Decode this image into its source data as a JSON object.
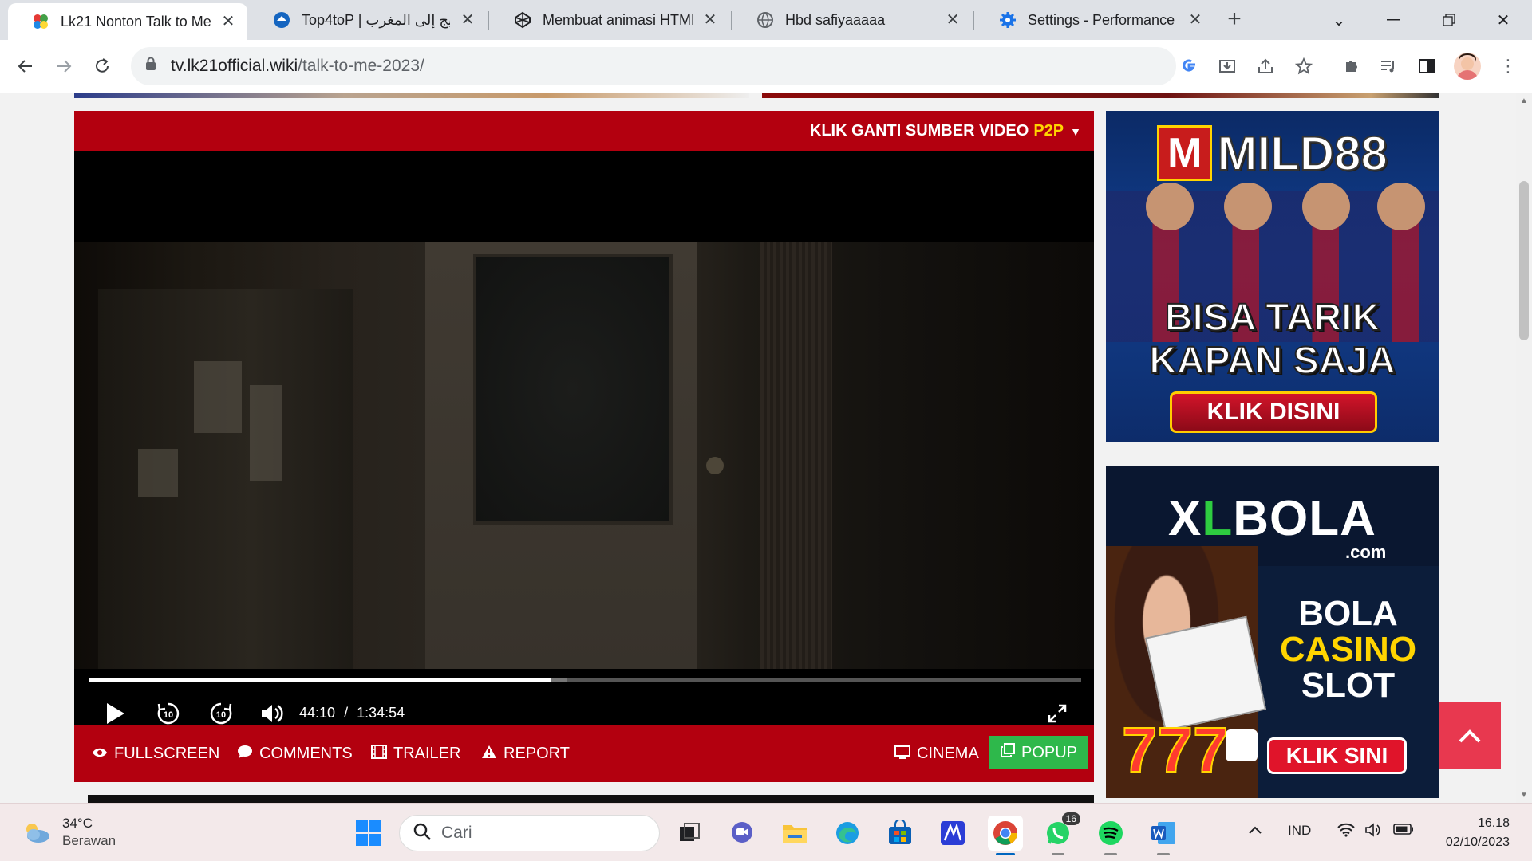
{
  "browser": {
    "tabs": [
      {
        "title": "Lk21 Nonton Talk to Me (",
        "active": true
      },
      {
        "title": "Top4toP | طليج إلى المغرب",
        "active": false
      },
      {
        "title": "Membuat animasi HTML",
        "active": false
      },
      {
        "title": "Hbd safiyaaaaa",
        "active": false
      },
      {
        "title": "Settings - Performance",
        "active": false
      }
    ],
    "url_host": "tv.lk21official.wiki",
    "url_path": "/talk-to-me-2023/"
  },
  "player": {
    "source_label": "KLIK GANTI SUMBER VIDEO",
    "source_value": "P2P",
    "current_time": "44:10",
    "separator": "/",
    "duration": "1:34:54",
    "progress_fraction": 0.4655,
    "buffer_fraction": 0.4815,
    "skip_seconds": "10",
    "actions": {
      "fullscreen": "FULLSCREEN",
      "comments": "COMMENTS",
      "trailer": "TRAILER",
      "report": "REPORT",
      "cinema": "CINEMA",
      "popup": "POPUP"
    }
  },
  "ads": {
    "ad1": {
      "brand_mark": "M",
      "brand_name": "MILD88",
      "line1": "BISA TARIK",
      "line2": "KAPAN SAJA",
      "cta": "KLIK DISINI"
    },
    "ad2": {
      "brand_x": "X",
      "brand_l": "L",
      "brand_rest": "BOLA",
      "brand_suffix": ".com",
      "line1": "BOLA",
      "line2": "CASINO",
      "line3": "SLOT",
      "cta": "KLIK SINI"
    }
  },
  "taskbar": {
    "weather_temp": "34°C",
    "weather_cond": "Berawan",
    "search_placeholder": "Cari",
    "whatsapp_badge": "16",
    "language": "IND",
    "time": "16.18",
    "date": "02/10/2023"
  },
  "colors": {
    "player_red": "#b3000f",
    "source_yellow": "#ffd400",
    "popup_green": "#2eb84b",
    "back_to_top": "#e8384f"
  }
}
